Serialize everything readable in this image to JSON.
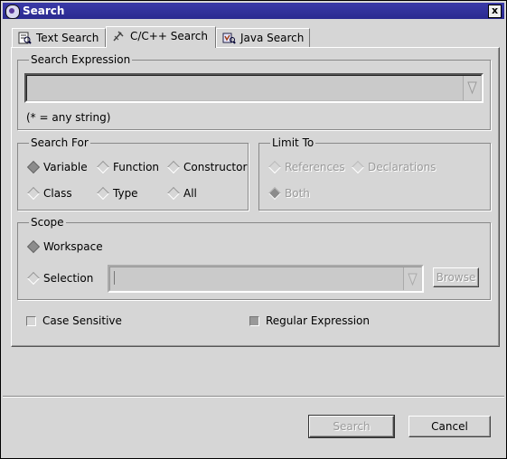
{
  "window": {
    "title": "Search",
    "close_label": "x"
  },
  "tabs": [
    {
      "label": "Text Search",
      "icon": "text-search-icon"
    },
    {
      "label": "C/C++ Search",
      "icon": "cpp-search-icon"
    },
    {
      "label": "Java Search",
      "icon": "java-search-icon"
    }
  ],
  "active_tab": "C/C++ Search",
  "search_expression": {
    "legend": "Search Expression",
    "value": "",
    "hint": "(* = any string)"
  },
  "search_for": {
    "legend": "Search For",
    "options": [
      "Variable",
      "Function",
      "Constructor",
      "Class",
      "Type",
      "All"
    ],
    "selected": "Variable"
  },
  "limit_to": {
    "legend": "Limit To",
    "options": [
      "References",
      "Declarations",
      "Both"
    ],
    "selected": "Both",
    "enabled": false
  },
  "scope": {
    "legend": "Scope",
    "options": [
      "Workspace",
      "Selection"
    ],
    "selected": "Workspace",
    "selection_value": "",
    "browse_label": "Browse"
  },
  "options": {
    "case_sensitive_label": "Case Sensitive",
    "case_sensitive": false,
    "regex_label": "Regular Expression",
    "regex": true
  },
  "buttons": {
    "search_label": "Search",
    "cancel_label": "Cancel"
  }
}
